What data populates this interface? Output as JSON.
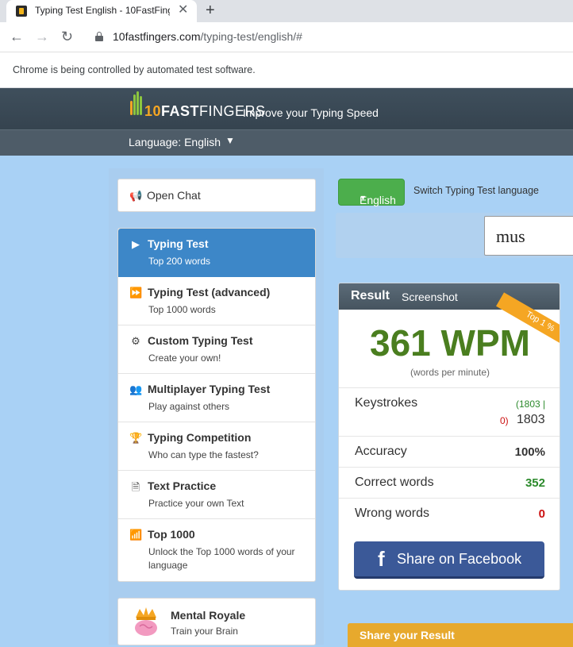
{
  "browser": {
    "tab_title": "Typing Test English - 10FastFinge",
    "tab_close": "✕",
    "new_tab": "+",
    "url_host": "10fastfingers.com",
    "url_path": "/typing-test/english/#",
    "automation_notice": "Chrome is being controlled by automated test software."
  },
  "header": {
    "logo_a": "10",
    "logo_b": "FAST",
    "logo_c": "FINGERS",
    "tagline": "Improve your Typing Speed",
    "language_label": "Language: English"
  },
  "sidebar": {
    "open_chat": "Open Chat",
    "items": [
      {
        "title": "Typing Test",
        "subtitle": "Top 200 words"
      },
      {
        "title": "Typing Test (advanced)",
        "subtitle": "Top 1000 words"
      },
      {
        "title": "Custom Typing Test",
        "subtitle": "Create your own!"
      },
      {
        "title": "Multiplayer Typing Test",
        "subtitle": "Play against others"
      },
      {
        "title": "Typing Competition",
        "subtitle": "Who can type the fastest?"
      },
      {
        "title": "Text Practice",
        "subtitle": "Practice your own Text"
      },
      {
        "title": "Top 1000",
        "subtitle": "Unlock the Top 1000 words of your language"
      }
    ],
    "royale_title": "Mental Royale",
    "royale_subtitle": "Train your Brain"
  },
  "main": {
    "language_button": "English",
    "switch_label": "Switch Typing Test language",
    "typed_text": "mus"
  },
  "result": {
    "title": "Result",
    "screenshot": "Screenshot",
    "badge": "Top 1 %",
    "wpm": "361 WPM",
    "wpm_sub": "(words per minute)",
    "keystrokes_label": "Keystrokes",
    "keystrokes_correct": "(1803 |",
    "keystrokes_wrong": "0)",
    "keystrokes_total": "1803",
    "accuracy_label": "Accuracy",
    "accuracy_value": "100%",
    "correct_label": "Correct words",
    "correct_value": "352",
    "wrong_label": "Wrong words",
    "wrong_value": "0",
    "facebook": "Share on Facebook"
  },
  "share_result": "Share your Result",
  "colors": {
    "accent_blue": "#3d87c8",
    "wpm_green": "#4a7e1f",
    "facebook": "#3b5998",
    "badge_orange": "#f5a623"
  }
}
